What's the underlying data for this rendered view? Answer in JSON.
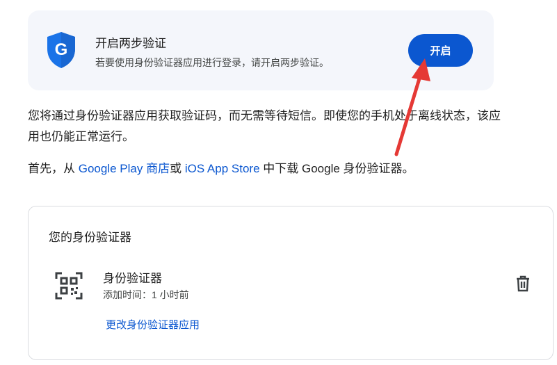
{
  "banner": {
    "title": "开启两步验证",
    "description": "若要使用身份验证器应用进行登录，请开启两步验证。",
    "button_label": "开启",
    "shield_letter": "G",
    "shield_icon": "google-shield-icon"
  },
  "intro": {
    "text": "您将通过身份验证器应用获取验证码，而无需等待短信。即使您的手机处于离线状态，该应用也仍能正常运行。",
    "step_prefix": "首先，从 ",
    "google_play_link": "Google Play 商店",
    "or": "或 ",
    "app_store_link": "iOS App Store",
    "step_suffix": " 中下载 Google 身份验证器。"
  },
  "card": {
    "title": "您的身份验证器",
    "item": {
      "icon": "qr-code-icon",
      "name": "身份验证器",
      "added_time": "添加时间：1 小时前",
      "delete_icon": "trash-icon"
    },
    "change_link": "更改身份验证器应用"
  },
  "colors": {
    "accent": "#0b57d0",
    "banner_bg": "#f4f6fb",
    "arrow": "#e53935"
  }
}
